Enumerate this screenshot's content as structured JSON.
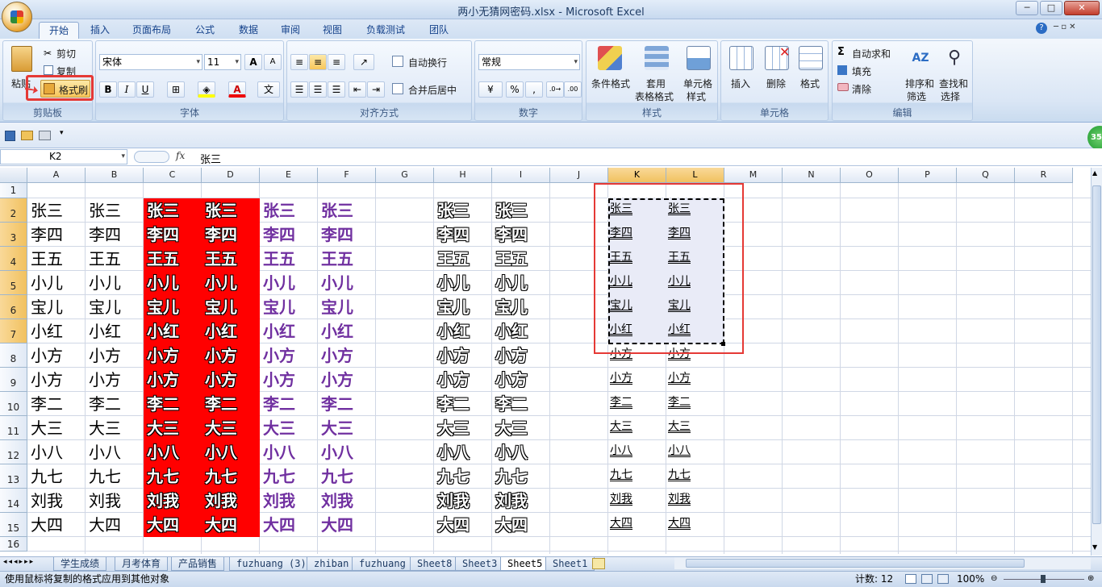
{
  "window": {
    "title": "两小无猜网密码.xlsx - Microsoft Excel",
    "min": "─",
    "max": "□",
    "close": "✕"
  },
  "tabs": [
    "开始",
    "插入",
    "页面布局",
    "公式",
    "数据",
    "审阅",
    "视图",
    "负载测试",
    "团队"
  ],
  "clipboard": {
    "paste": "粘贴",
    "cut": "剪切",
    "copy": "复制",
    "format_painter": "格式刷",
    "label": "剪贴板"
  },
  "font": {
    "name": "宋体",
    "size": "11",
    "grow": "A",
    "shrink": "A",
    "bold": "B",
    "italic": "I",
    "underline": "U",
    "phonetic": "文",
    "label": "字体"
  },
  "alignment": {
    "wrap": "自动换行",
    "merge": "合并后居中",
    "label": "对齐方式"
  },
  "number": {
    "format": "常规",
    "percent": "%",
    "comma": ",",
    "label": "数字"
  },
  "styles": {
    "conditional": "条件格式",
    "table": "套用",
    "table2": "表格格式",
    "cell": "单元格",
    "cell2": "样式",
    "label": "样式"
  },
  "cells": {
    "insert": "插入",
    "delete": "删除",
    "format": "格式",
    "label": "单元格"
  },
  "editing": {
    "autosum": "自动求和",
    "fill": "填充",
    "clear": "清除",
    "sort": "排序和",
    "sort2": "筛选",
    "find": "查找和",
    "find2": "选择",
    "label": "编辑"
  },
  "formula": {
    "namebox": "K2",
    "fx": "fx",
    "value": "张三"
  },
  "columns": [
    "A",
    "B",
    "C",
    "D",
    "E",
    "F",
    "G",
    "H",
    "I",
    "J",
    "K",
    "L",
    "M",
    "N",
    "O",
    "P",
    "Q",
    "R"
  ],
  "rows": [
    "1",
    "2",
    "3",
    "4",
    "5",
    "6",
    "7",
    "8",
    "9",
    "10",
    "11",
    "12",
    "13",
    "14",
    "15",
    "16"
  ],
  "names": [
    "张三",
    "李四",
    "王五",
    "小儿",
    "宝儿",
    "小红",
    "小方",
    "小方",
    "李二",
    "大三",
    "小八",
    "九七",
    "刘我",
    "大四"
  ],
  "sheets": [
    "学生成绩",
    "月考体育",
    "产品销售",
    "fuzhuang (3)",
    "zhiban",
    "fuzhuang",
    "Sheet8",
    "Sheet3",
    "Sheet5",
    "Sheet1"
  ],
  "active_sheet": "Sheet5",
  "status": {
    "message": "使用鼠标将复制的格式应用到其他对象",
    "count": "计数: 12",
    "zoom": "100%"
  },
  "badge": "35",
  "colors": {
    "red_fill": "#ff0000",
    "purple": "#7030a0",
    "highlight": "#e53935"
  }
}
